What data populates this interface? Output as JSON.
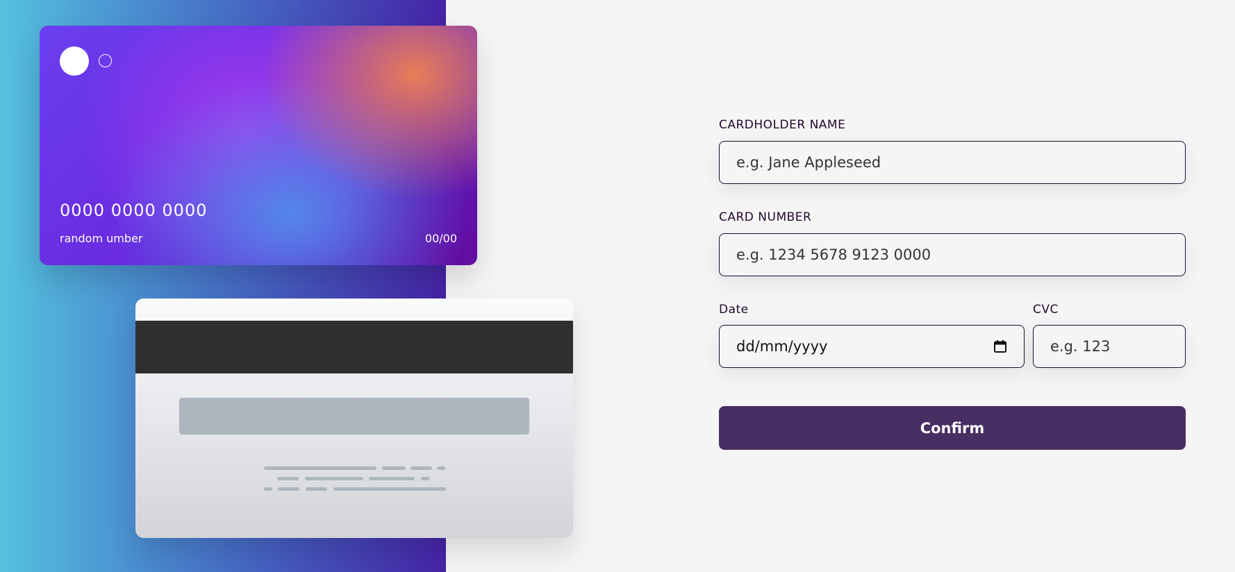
{
  "card_front": {
    "number": "0000 0000 0000",
    "name": "random umber",
    "expiry": "00/00"
  },
  "form": {
    "name_label": "CARDHOLDER NAME",
    "name_placeholder": "e.g. Jane Appleseed",
    "number_label": "CARD NUMBER",
    "number_placeholder": "e.g. 1234 5678 9123 0000",
    "date_label": "Date",
    "date_value": "dd/mm/yyyy",
    "cvc_label": "CVC",
    "cvc_placeholder": "e.g. 123",
    "confirm_label": "Confirm"
  },
  "colors": {
    "panel_gradient_start": "#55c1de",
    "panel_gradient_end": "#4524a6",
    "button": "#472e63",
    "label": "#21092f"
  },
  "icons": {
    "calendar": "calendar-icon"
  }
}
